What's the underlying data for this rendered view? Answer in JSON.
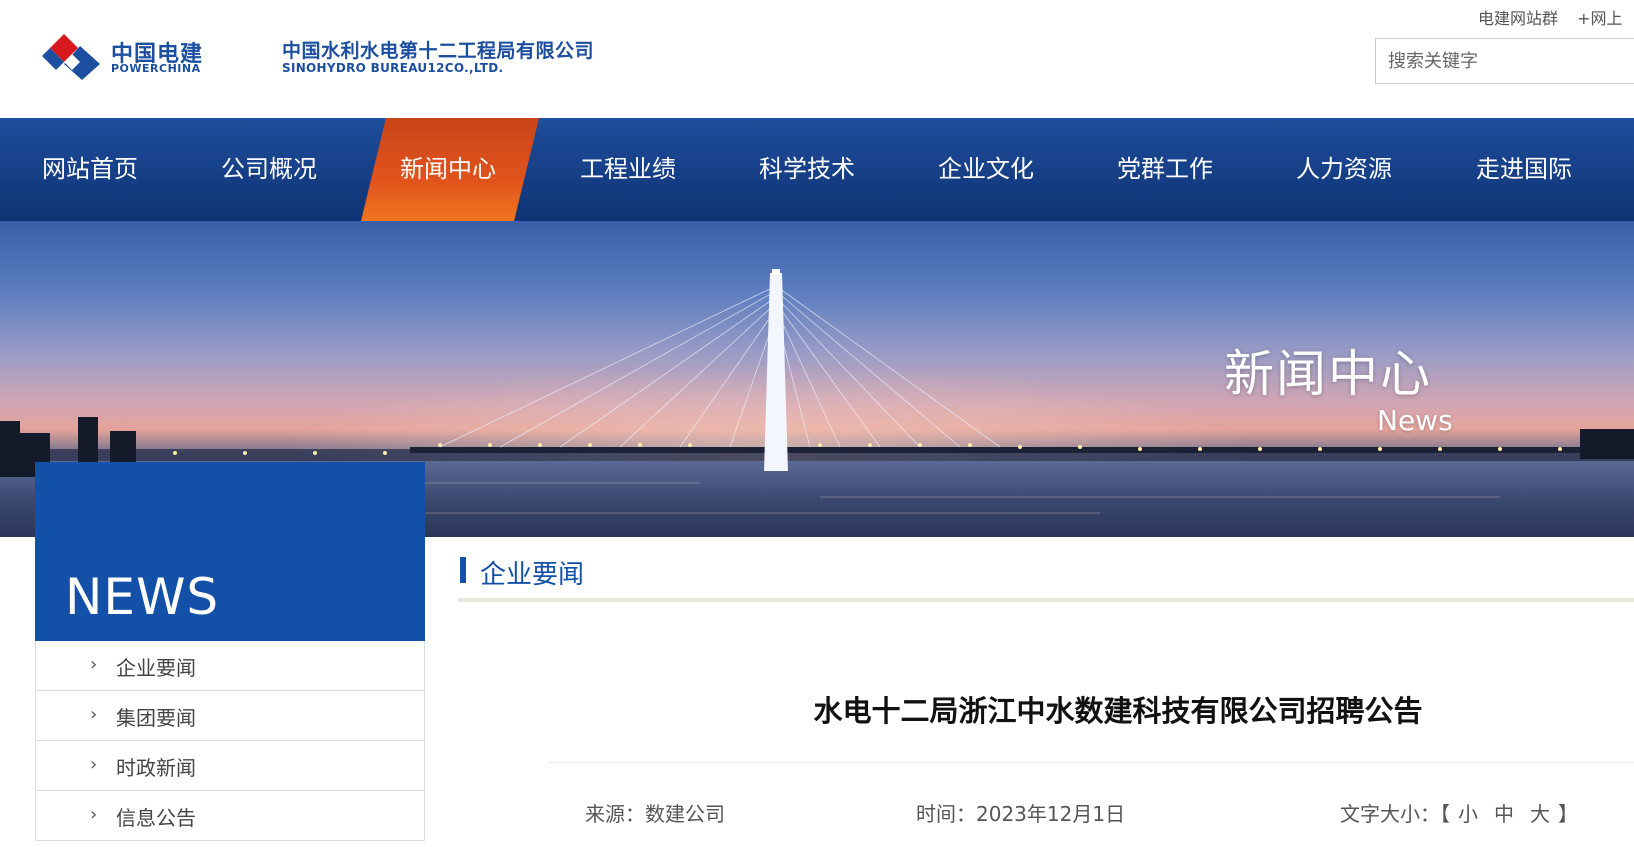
{
  "header": {
    "logo_cn": "中国电建",
    "logo_en": "POWERCHINA",
    "company_cn": "中国水利水电第十二工程局有限公司",
    "company_en": "SINOHYDRO BUREAU12CO.,LTD.",
    "top_links": [
      "电建网站群",
      "+网上"
    ],
    "search_placeholder": "搜索关键字"
  },
  "nav": {
    "items": [
      "网站首页",
      "公司概况",
      "新闻中心",
      "工程业绩",
      "科学技术",
      "企业文化",
      "党群工作",
      "人力资源",
      "走进国际"
    ],
    "active": "新闻中心"
  },
  "banner": {
    "title": "新闻中心",
    "subtitle": "News"
  },
  "sidebar": {
    "heading": "NEWS",
    "items": [
      "企业要闻",
      "集团要闻",
      "时政新闻",
      "信息公告"
    ]
  },
  "main": {
    "section_title": "企业要闻",
    "article_title": "水电十二局浙江中水数建科技有限公司招聘公告",
    "source": "来源：数建公司",
    "date": "时间：2023年12月1日",
    "font_size_label": "文字大小：",
    "font_open": "【",
    "font_sizes": [
      "小",
      "中",
      "大"
    ],
    "font_close": "】"
  },
  "colors": {
    "brand_blue": "#1351a8",
    "nav_active": "#e0531c",
    "logo_red": "#d7191f"
  }
}
